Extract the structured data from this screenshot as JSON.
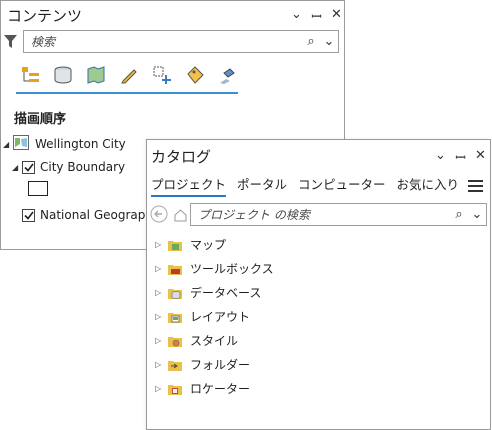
{
  "contents": {
    "title": "コンテンツ",
    "search_placeholder": "検索",
    "drawing_order_heading": "描画順序",
    "map_name": "Wellington City",
    "layers": [
      {
        "label": "City Boundary",
        "checked": true
      },
      {
        "label": "National Geographic",
        "checked": true
      }
    ]
  },
  "catalog": {
    "title": "カタログ",
    "tabs": [
      "プロジェクト",
      "ポータル",
      "コンピューター",
      "お気に入り"
    ],
    "active_tab": "プロジェクト",
    "search_placeholder": "プロジェクト の検索",
    "items": [
      {
        "label": "マップ",
        "icon": "map-folder-icon"
      },
      {
        "label": "ツールボックス",
        "icon": "toolbox-folder-icon"
      },
      {
        "label": "データベース",
        "icon": "database-folder-icon"
      },
      {
        "label": "レイアウト",
        "icon": "layout-folder-icon"
      },
      {
        "label": "スタイル",
        "icon": "style-folder-icon"
      },
      {
        "label": "フォルダー",
        "icon": "folder-icon"
      },
      {
        "label": "ロケーター",
        "icon": "locator-folder-icon"
      }
    ]
  },
  "colors": {
    "accent": "#2b79c2",
    "folder_yellow": "#e8c14a",
    "border": "#9a9a9a"
  }
}
